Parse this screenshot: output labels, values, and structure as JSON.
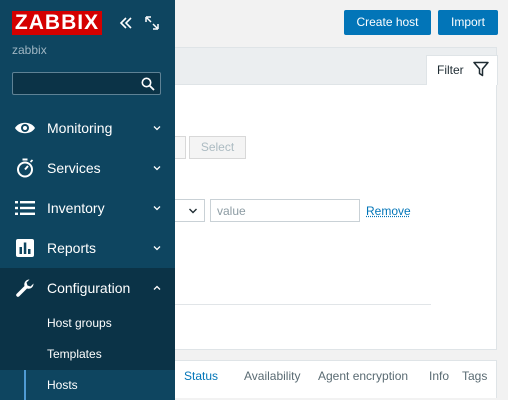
{
  "sidebar": {
    "logo": "ZABBIX",
    "server_name": "zabbix",
    "search": {
      "value": "",
      "placeholder": ""
    },
    "menu": [
      {
        "label": "Monitoring",
        "icon": "eye-icon"
      },
      {
        "label": "Services",
        "icon": "stopwatch-icon"
      },
      {
        "label": "Inventory",
        "icon": "list-icon"
      },
      {
        "label": "Reports",
        "icon": "bar-chart-icon"
      },
      {
        "label": "Configuration",
        "icon": "wrench-icon",
        "expanded": true
      }
    ],
    "submenu": [
      {
        "label": "Host groups"
      },
      {
        "label": "Templates"
      },
      {
        "label": "Hosts",
        "current": true
      }
    ]
  },
  "header": {
    "create_host": "Create host",
    "import": "Import"
  },
  "filter": {
    "tab_label": "Filter",
    "select_button": "Select",
    "tag_value": {
      "value": "",
      "placeholder": "value"
    },
    "remove_link": "Remove"
  },
  "table": {
    "columns": [
      "Status",
      "Availability",
      "Agent encryption",
      "Info",
      "Tags"
    ]
  },
  "colors": {
    "sidebar_bg": "#0e4560",
    "logo_red": "#d40000",
    "primary_button": "#0275b8",
    "link": "#0275b8"
  }
}
